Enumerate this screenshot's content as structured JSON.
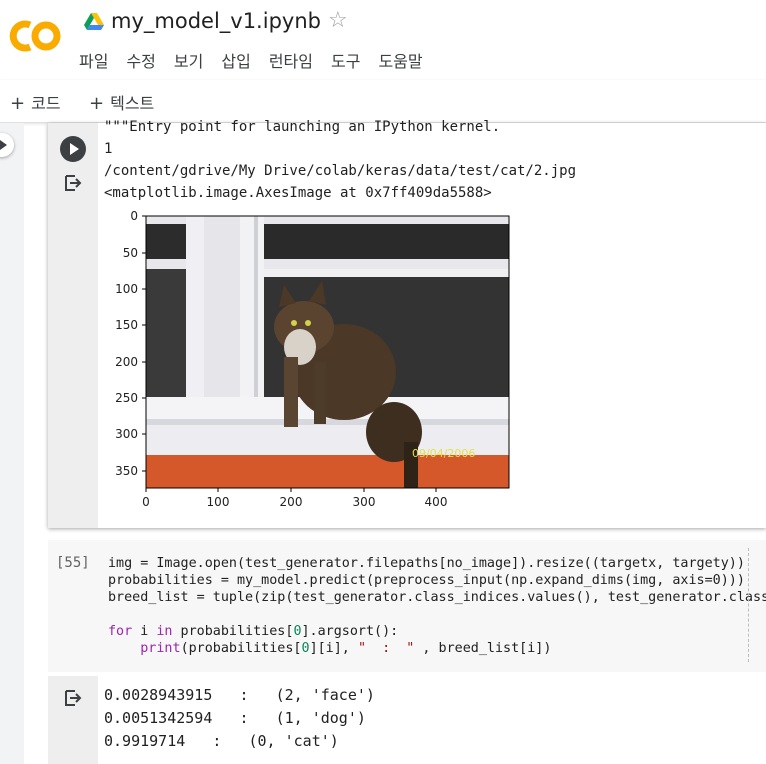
{
  "header": {
    "title": "my_model_v1.ipynb",
    "logo_text": "CO",
    "menu": [
      "파일",
      "수정",
      "보기",
      "삽입",
      "런타임",
      "도구",
      "도움말"
    ]
  },
  "toolbar": {
    "add_code": "코드",
    "add_text": "텍스트"
  },
  "cell1": {
    "output_lines": [
      "\"\"\"Entry point for launching an IPython kernel.",
      "1",
      "/content/gdrive/My Drive/colab/keras/data/test/cat/2.jpg",
      "<matplotlib.image.AxesImage at 0x7ff409da5588>"
    ],
    "plot": {
      "yticks": [
        "0",
        "50",
        "100",
        "150",
        "200",
        "250",
        "300",
        "350"
      ],
      "xticks": [
        "0",
        "100",
        "200",
        "300",
        "400"
      ],
      "photo_stamp": "09/04/2006"
    }
  },
  "cell2": {
    "exec_count": "[55]",
    "code_lines": [
      "img = Image.open(test_generator.filepaths[no_image]).resize((targetx, targety))",
      "probabilities = my_model.predict(preprocess_input(np.expand_dims(img, axis=0)))",
      "breed_list = tuple(zip(test_generator.class_indices.values(), test_generator.class_",
      "",
      "for i in probabilities[0].argsort():",
      "    print(probabilities[0][i], \"  :  \" , breed_list[i])"
    ]
  },
  "cell3": {
    "output_lines": [
      "0.0028943915   :   (2, 'face')",
      "0.0051342594   :   (1, 'dog')",
      "0.9919714   :   (0, 'cat')"
    ]
  },
  "colors": {
    "logo_orange": "#F9AB00",
    "keyword_purple": "#9c27b0",
    "string_red": "#a31515"
  }
}
